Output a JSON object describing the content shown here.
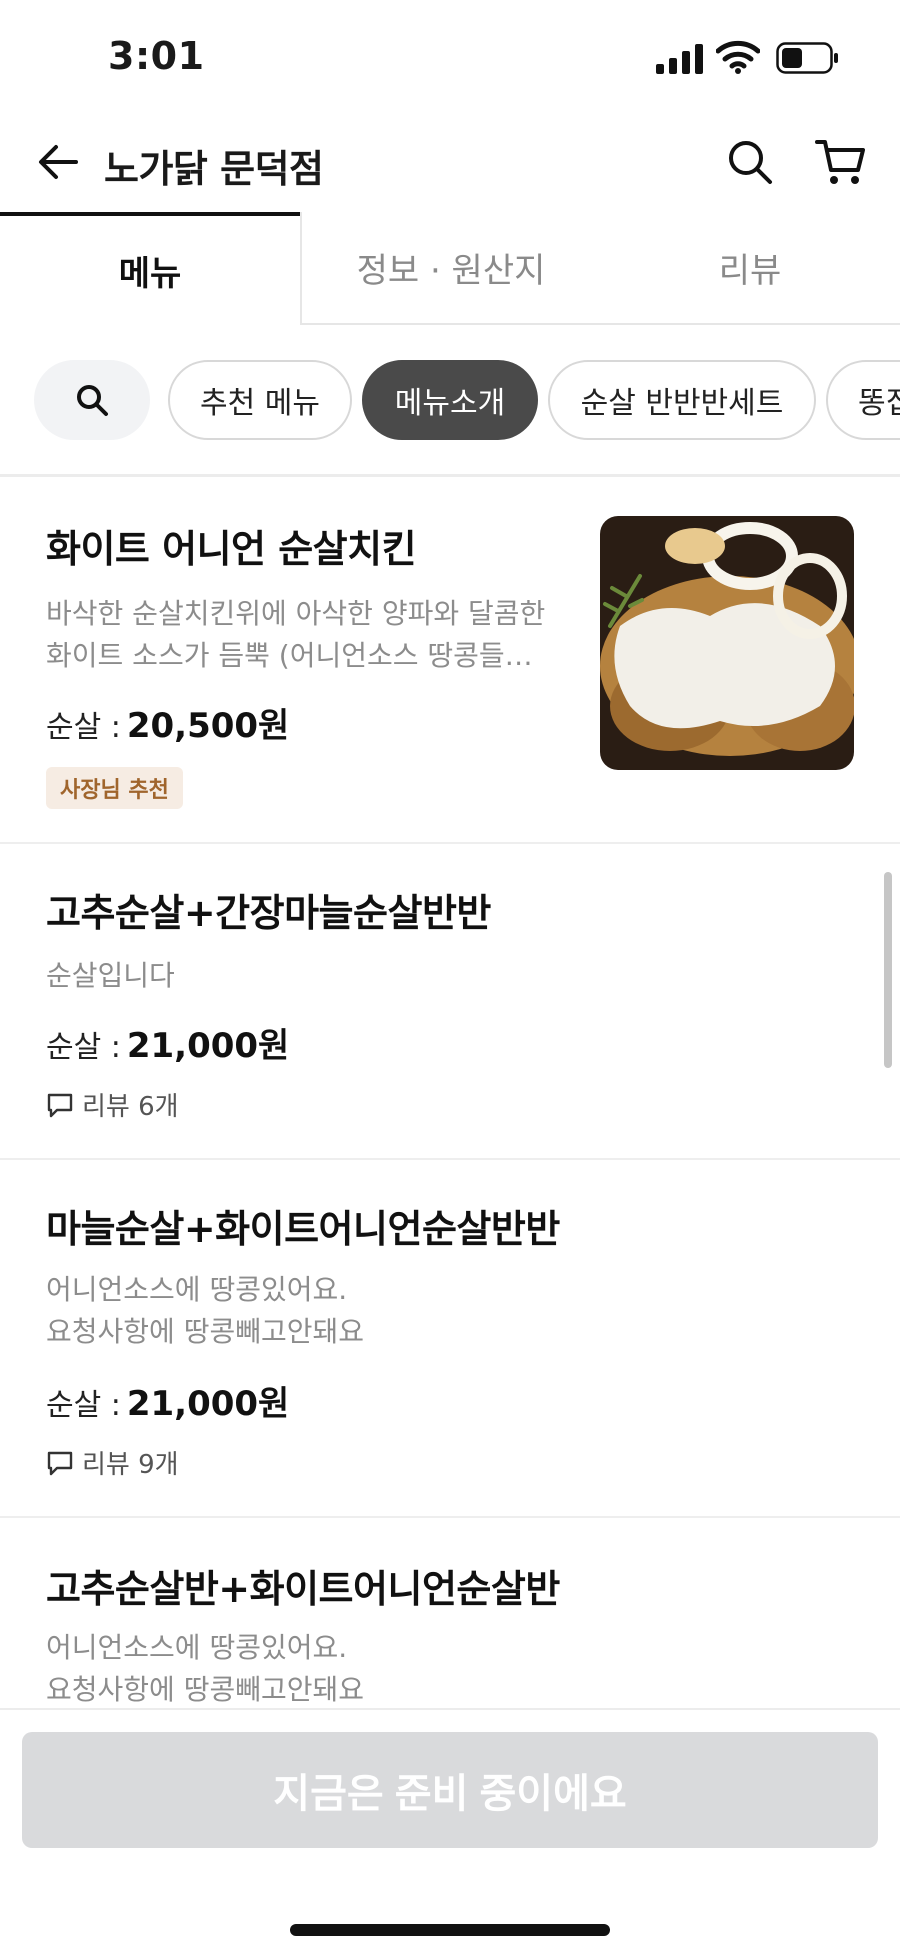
{
  "status_bar": {
    "time": "3:01"
  },
  "header": {
    "title": "노가닭 문덕점"
  },
  "tabs": [
    {
      "label": "메뉴",
      "active": true
    },
    {
      "label": "정보 · 원산지",
      "active": false
    },
    {
      "label": "리뷰",
      "active": false
    }
  ],
  "chips": [
    {
      "label": "추천 메뉴",
      "selected": false
    },
    {
      "label": "메뉴소개",
      "selected": true
    },
    {
      "label": "순살 반반반세트",
      "selected": false
    },
    {
      "label": "똥집",
      "selected": false
    }
  ],
  "menu_items": [
    {
      "name": "화이트 어니언 순살치킨",
      "desc": [
        "바삭한 순살치킨위에 아삭한 양파와 달콤한",
        "화이트 소스가 듬뿍 (어니언소스 땅콩들…"
      ],
      "price_label": "순살 :",
      "price": "20,500원",
      "badge": "사장님 추천",
      "has_photo": true
    },
    {
      "name": "고추순살+간장마늘순살반반",
      "desc": [
        "순살입니다"
      ],
      "price_label": "순살 :",
      "price": "21,000원",
      "review": "리뷰 6개"
    },
    {
      "name": "마늘순살+화이트어니언순살반반",
      "desc": [
        "어니언소스에 땅콩있어요.",
        "요청사항에 땅콩빼고안돼요"
      ],
      "price_label": "순살 :",
      "price": "21,000원",
      "review": "리뷰 9개"
    },
    {
      "name": "고추순살반+화이트어니언순살반",
      "desc": [
        "어니언소스에 땅콩있어요.",
        "요청사항에 땅콩빼고안돼요"
      ]
    }
  ],
  "bottom": {
    "button_label": "지금은 준비 중이에요"
  },
  "colors": {
    "selected_chip": "#4a4a4a",
    "badge_bg": "#f6ece3",
    "badge_text": "#a0652c",
    "disabled_button": "#d9dadc"
  }
}
